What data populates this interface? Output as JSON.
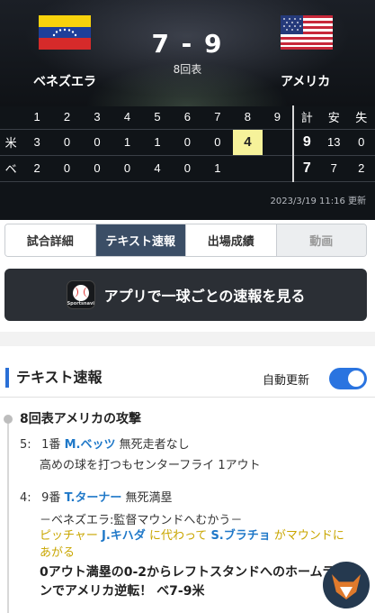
{
  "header": {
    "home_team": "ベネズエラ",
    "away_team": "アメリカ",
    "score": "7 - 9",
    "inning": "8回表",
    "updated": "2023/3/19 11:16 更新"
  },
  "box": {
    "innings": [
      "1",
      "2",
      "3",
      "4",
      "5",
      "6",
      "7",
      "8",
      "9"
    ],
    "total_labels": [
      "計",
      "安",
      "失"
    ],
    "rows": [
      {
        "team": "米",
        "runs": [
          "3",
          "0",
          "0",
          "1",
          "1",
          "0",
          "0",
          "4",
          ""
        ],
        "totals": [
          "9",
          "13",
          "0"
        ]
      },
      {
        "team": "ベ",
        "runs": [
          "2",
          "0",
          "0",
          "0",
          "4",
          "0",
          "1",
          "",
          ""
        ],
        "totals": [
          "7",
          "7",
          "2"
        ]
      }
    ]
  },
  "tabs": [
    {
      "label": "試合詳細"
    },
    {
      "label": "テキスト速報"
    },
    {
      "label": "出場成績"
    },
    {
      "label": "動画"
    }
  ],
  "banner": {
    "label": "アプリで一球ごとの速報を見る",
    "icon_text": "Sportsnavi"
  },
  "live": {
    "title": "テキスト速報",
    "auto_update_label": "自動更新",
    "auto_update_on": true,
    "inning_heading": "8回表アメリカの攻撃",
    "play1": {
      "no": "5:",
      "order": "1番",
      "batter": "M.ベッツ",
      "situation": "無死走者なし",
      "detail": "高めの球を打つもセンターフライ 1アウト"
    },
    "play2": {
      "no": "4:",
      "order": "9番",
      "batter": "T.ターナー",
      "situation": "無死満塁",
      "event": "－ベネズエラ:監督マウンドへむかう－",
      "pitch_change_prefix": "ピッチャー",
      "pitcher_in": "J.キハダ",
      "pitch_change_mid": "に代わって",
      "pitcher_out": "S.ブラチョ",
      "pitch_change_suffix": "がマウンドにあがる",
      "result": "0アウト満塁の0-2からレフトスタンドへのホームランでアメリカ逆転！ ベ7-9米"
    }
  },
  "colors": {
    "accent_blue": "#2a74e0",
    "player_blue": "#1f78c8",
    "highlight_yellow": "#f6f29a",
    "active_tab": "#3b4e66"
  }
}
